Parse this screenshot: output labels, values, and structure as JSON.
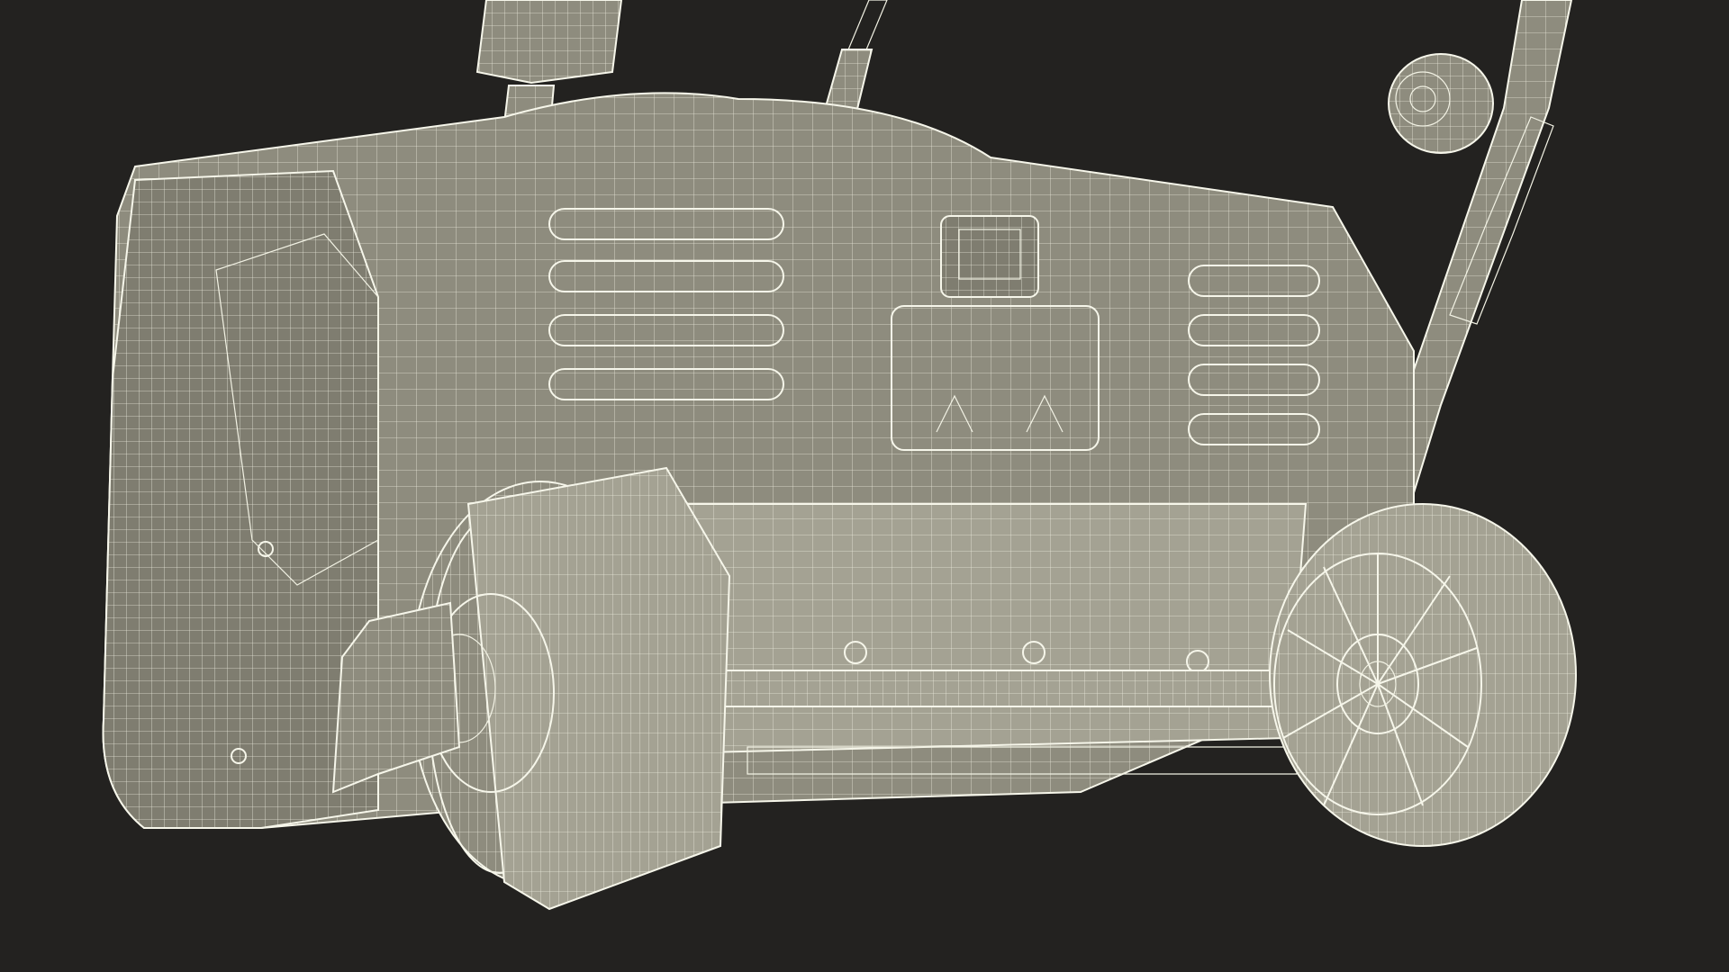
{
  "scene": {
    "subject": "wireframe-lawn-mower-scarifier",
    "render_style": "wireframe-over-shaded",
    "colors": {
      "background": "#232220",
      "body_fill": "#8e8c7e",
      "body_shadow": "#6f6d61",
      "body_light": "#a4a293",
      "vent_fill": "#5a584e",
      "wire": "#f2f2e4"
    },
    "visible_parts": [
      "handle",
      "power-cable",
      "motor-housing",
      "vent-slots-left",
      "vent-slots-right",
      "switch-button",
      "label-plate",
      "side-cover",
      "rear-wheel-left",
      "rear-wheel-right",
      "axle",
      "height-adjust-knob"
    ]
  }
}
